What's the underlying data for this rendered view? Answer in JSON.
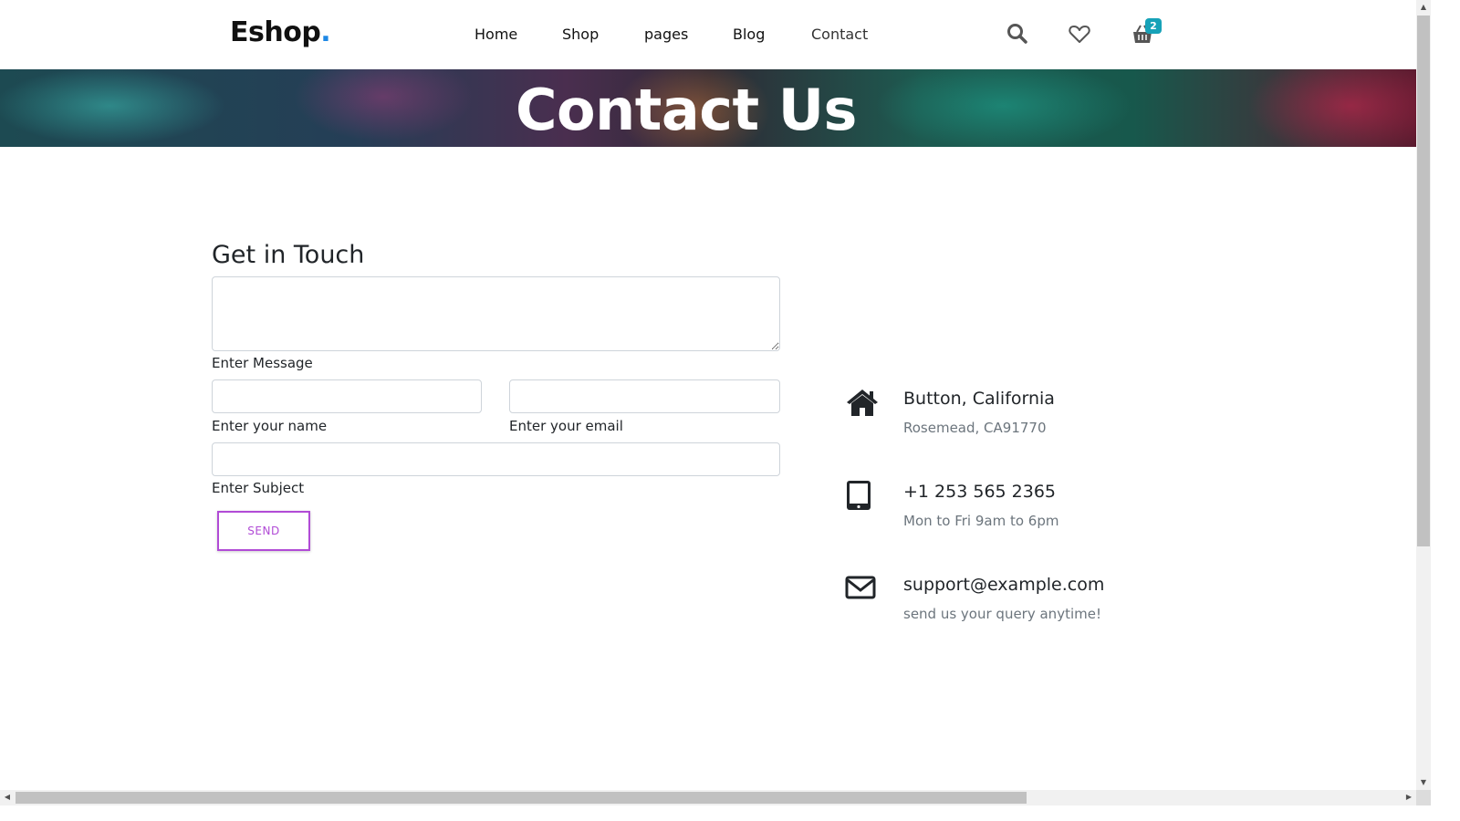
{
  "header": {
    "logo_text": "Eshop",
    "logo_dot": ".",
    "nav": [
      {
        "label": "Home"
      },
      {
        "label": "Shop"
      },
      {
        "label": "pages"
      },
      {
        "label": "Blog"
      },
      {
        "label": "Contact"
      }
    ],
    "icons": [
      "search-icon",
      "heart-icon",
      "basket-icon"
    ],
    "cart_count": "2"
  },
  "banner": {
    "title": "Contact Us"
  },
  "form": {
    "title": "Get in Touch",
    "message_label": "Enter Message",
    "name_label": "Enter your name",
    "email_label": "Enter your email",
    "subject_label": "Enter Subject",
    "send_label": "SEND"
  },
  "info": [
    {
      "icon": "home-icon",
      "title": "Button, California",
      "sub": "Rosemead, CA91770"
    },
    {
      "icon": "tablet-icon",
      "title": "+1 253 565 2365",
      "sub": "Mon to Fri 9am to 6pm"
    },
    {
      "icon": "mail-icon",
      "title": "support@example.com",
      "sub": "send us your query anytime!"
    }
  ],
  "colors": {
    "accent_button": "#b14bd6",
    "badge": "#17a2b8",
    "logo_dot": "#1e88e5"
  }
}
